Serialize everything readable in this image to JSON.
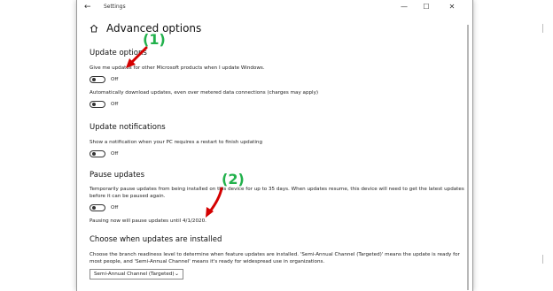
{
  "window": {
    "title": "Settings",
    "back_icon": "back-arrow-icon",
    "min_label": "—",
    "max_label": "☐",
    "close_label": "✕"
  },
  "page": {
    "home_icon": "home-icon",
    "title": "Advanced options"
  },
  "update_options": {
    "heading": "Update options",
    "items": [
      {
        "label": "Give me updates for other Microsoft products when I update Windows.",
        "state": "Off"
      },
      {
        "label": "Automatically download updates, even over metered data connections (charges may apply)",
        "state": "Off"
      }
    ]
  },
  "update_notifications": {
    "heading": "Update notifications",
    "items": [
      {
        "label": "Show a notification when your PC requires a restart to finish updating",
        "state": "Off"
      }
    ]
  },
  "pause_updates": {
    "heading": "Pause updates",
    "description": "Temporarily pause updates from being installed on this device for up to 35 days. When updates resume, this device will need to get the latest updates before it can be paused again.",
    "toggle_state": "Off",
    "status": "Pausing now will pause updates until 4/1/2020."
  },
  "branch": {
    "heading": "Choose when updates are installed",
    "description": "Choose the branch readiness level to determine when feature updates are installed. 'Semi-Annual Channel (Targeted)' means the update is ready for most people, and 'Semi-Annual Channel' means it's ready for widespread use in organizations.",
    "selected": "Semi-Annual Channel (Targeted)"
  },
  "annotations": {
    "first": "(1)",
    "second": "(2)",
    "annotation_color": "#22b14c",
    "arrow_color": "#d40000"
  },
  "colors": {
    "toggle_off": "#333333",
    "background": "#ffffff"
  }
}
